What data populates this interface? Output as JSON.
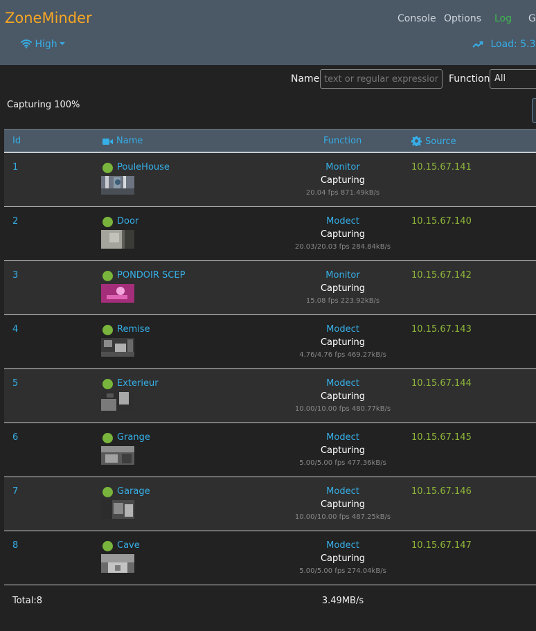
{
  "app": {
    "brand": "ZoneMinder"
  },
  "nav": {
    "console": "Console",
    "options": "Options",
    "log": "Log",
    "groups": "Gr"
  },
  "bandwidth": {
    "label": "High"
  },
  "load": {
    "label": "Load: 5.3"
  },
  "filters": {
    "name_label": "Name",
    "name_placeholder": "text or regular expression",
    "function_label": "Function",
    "function_value": "All"
  },
  "status": {
    "text": "Capturing 100%"
  },
  "table": {
    "headers": {
      "id": "Id",
      "name": "Name",
      "function": "Function",
      "source": "Source"
    },
    "rows": [
      {
        "id": "1",
        "name": "PouleHouse",
        "mode": "Monitor",
        "status": "Capturing",
        "stats": "20.04 fps 871.49kB/s",
        "source": "10.15.67.141"
      },
      {
        "id": "2",
        "name": "Door",
        "mode": "Modect",
        "status": "Capturing",
        "stats": "20.03/20.03 fps 284.84kB/s",
        "source": "10.15.67.140"
      },
      {
        "id": "3",
        "name": "PONDOIR SCEP",
        "mode": "Monitor",
        "status": "Capturing",
        "stats": "15.08 fps 223.92kB/s",
        "source": "10.15.67.142"
      },
      {
        "id": "4",
        "name": "Remise",
        "mode": "Modect",
        "status": "Capturing",
        "stats": "4.76/4.76 fps 469.27kB/s",
        "source": "10.15.67.143"
      },
      {
        "id": "5",
        "name": "Exterieur",
        "mode": "Modect",
        "status": "Capturing",
        "stats": "10.00/10.00 fps 480.77kB/s",
        "source": "10.15.67.144"
      },
      {
        "id": "6",
        "name": "Grange",
        "mode": "Modect",
        "status": "Capturing",
        "stats": "5.00/5.00 fps 477.36kB/s",
        "source": "10.15.67.145"
      },
      {
        "id": "7",
        "name": "Garage",
        "mode": "Modect",
        "status": "Capturing",
        "stats": "10.00/10.00 fps 487.25kB/s",
        "source": "10.15.67.146"
      },
      {
        "id": "8",
        "name": "Cave",
        "mode": "Modect",
        "status": "Capturing",
        "stats": "5.00/5.00 fps 274.04kB/s",
        "source": "10.15.67.147"
      }
    ],
    "footer": {
      "total": "Total:8",
      "bandwidth": "3.49MB/s"
    }
  }
}
